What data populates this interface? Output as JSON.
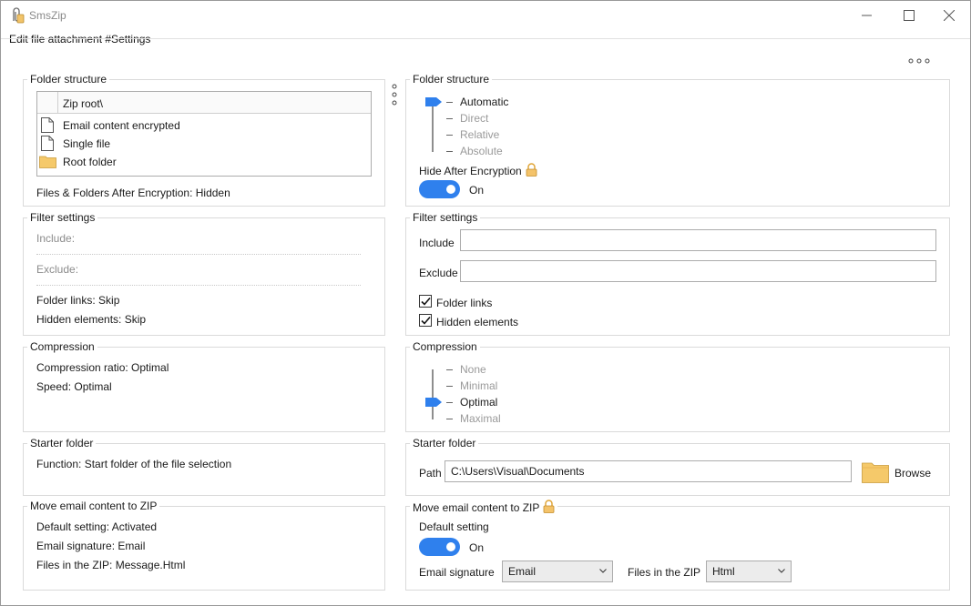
{
  "window": {
    "title": "SmsZip",
    "subtitle": "Edit file attachment #Settings"
  },
  "left": {
    "folder_structure": {
      "legend": "Folder structure",
      "tree_header": "Zip root\\",
      "items": [
        {
          "label": "Email content encrypted",
          "icon": "file-icon"
        },
        {
          "label": "Single file",
          "icon": "file-icon"
        },
        {
          "label": "Root folder",
          "icon": "folder-icon"
        }
      ],
      "after_encryption": "Files & Folders After Encryption:  Hidden"
    },
    "filter": {
      "legend": "Filter settings",
      "include": "Include:",
      "exclude": "Exclude:",
      "folder_links": "Folder links:  Skip",
      "hidden_elements": "Hidden elements:  Skip"
    },
    "compression": {
      "legend": "Compression",
      "ratio": "Compression ratio:  Optimal",
      "speed": "Speed:  Optimal"
    },
    "starter": {
      "legend": "Starter folder",
      "function": "Function:  Start folder of the file selection"
    },
    "move_email": {
      "legend": "Move email content to ZIP",
      "default": "Default setting:  Activated",
      "signature": "Email signature:  Email",
      "files": "Files in the ZIP:  Message.Html"
    }
  },
  "right": {
    "folder_structure": {
      "legend": "Folder structure",
      "options": [
        "Automatic",
        "Direct",
        "Relative",
        "Absolute"
      ],
      "selected_index": 0,
      "hide_label": "Hide After Encryption",
      "toggle_state": "On"
    },
    "filter": {
      "legend": "Filter settings",
      "include_label": "Include",
      "include_value": "",
      "exclude_label": "Exclude",
      "exclude_value": "",
      "folder_links": "Folder links",
      "folder_links_checked": true,
      "hidden_elements": "Hidden elements",
      "hidden_elements_checked": true
    },
    "compression": {
      "legend": "Compression",
      "options": [
        "None",
        "Minimal",
        "Optimal",
        "Maximal"
      ],
      "selected_index": 2
    },
    "starter": {
      "legend": "Starter folder",
      "path_label": "Path",
      "path_value": "C:\\Users\\Visual\\Documents",
      "browse_label": "Browse"
    },
    "move_email": {
      "legend": "Move email content to ZIP",
      "default_label": "Default setting",
      "toggle_state": "On",
      "signature_label": "Email signature",
      "signature_value": "Email",
      "files_label": "Files in the ZIP",
      "files_value": "Html"
    }
  },
  "colors": {
    "accent": "#2f80ed",
    "folder": "#f5c96a",
    "lock": "#e0a63a"
  }
}
